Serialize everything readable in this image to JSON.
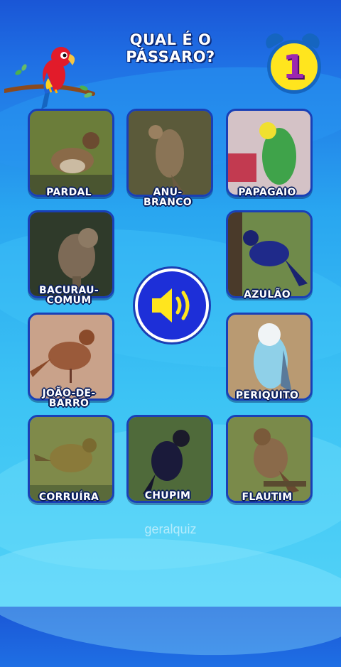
{
  "title": {
    "line1": "QUAL É O",
    "line2": "PÁSSARO?"
  },
  "round": {
    "number": "1"
  },
  "birds": [
    {
      "label": [
        "PARDAL"
      ],
      "bg": "#6b7d3a",
      "body": "#8a6a48"
    },
    {
      "label": [
        "ANU-",
        "BRANCO"
      ],
      "bg": "#5b5a3a",
      "body": "#8a7456"
    },
    {
      "label": [
        "PAPAGAIO"
      ],
      "bg": "#d4c2c6",
      "body": "#3fa34a"
    },
    {
      "label": [
        "BACURAU-",
        "COMUM"
      ],
      "bg": "#2f3a2a",
      "body": "#7d6a56"
    },
    {
      "label": [
        "AZULÃO"
      ],
      "bg": "#6f8a4a",
      "body": "#1f2a8a"
    },
    {
      "label": [
        "JOÃO-DE-",
        "BARRO"
      ],
      "bg": "#c9a28a",
      "body": "#9a5a3a"
    },
    {
      "label": [
        "PERIQUITO"
      ],
      "bg": "#b99a72",
      "body": "#8fd0e8"
    },
    {
      "label": [
        "CORRUÍRA"
      ],
      "bg": "#7f8a4a",
      "body": "#8a7a3a"
    },
    {
      "label": [
        "CHUPIM"
      ],
      "bg": "#4f6a3a",
      "body": "#1a1a3a"
    },
    {
      "label": [
        "FLAUTIM"
      ],
      "bg": "#7a8a4a",
      "body": "#8a6a4a"
    }
  ],
  "watermark": "geralquiz",
  "colors": {
    "card_border": "#1a3fb5",
    "speaker_bg": "#1d2fd8",
    "speaker_icon": "#ffe51e",
    "clock_face": "#ffe51e"
  },
  "icons": {
    "speaker": "speaker-icon",
    "alarm_clock": "alarm-clock-icon",
    "parrot": "parrot-mascot"
  }
}
